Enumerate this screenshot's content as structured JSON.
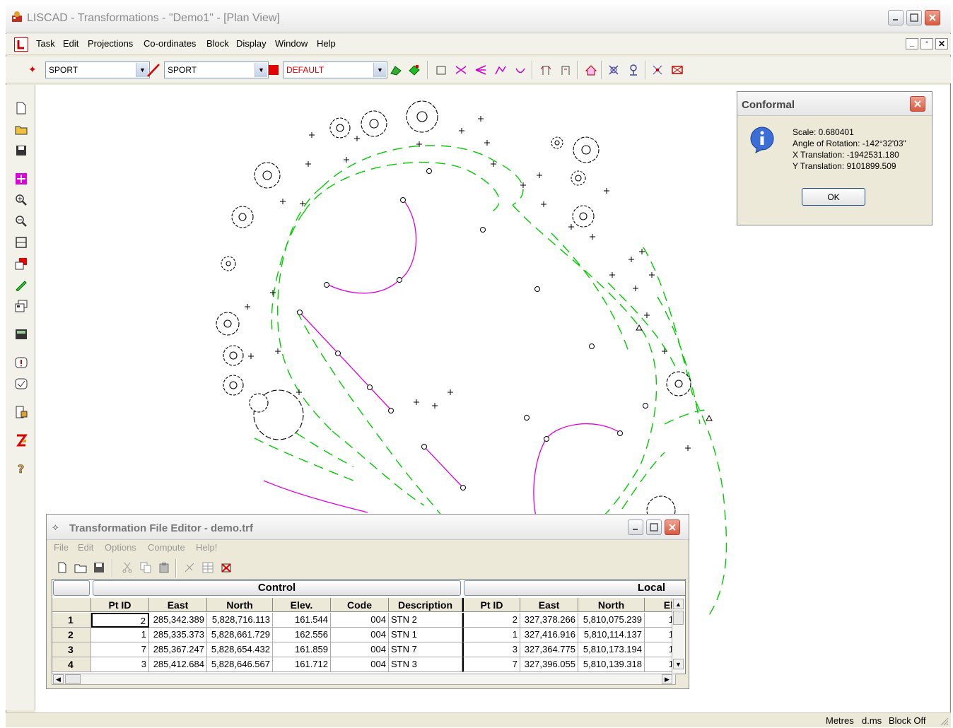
{
  "app": {
    "title": "LISCAD - Transformations - \"Demo1\" - [Plan View]"
  },
  "menubar": {
    "items": [
      "Task",
      "Edit",
      "Projections",
      "Co-ordinates",
      "Block",
      "Display",
      "Window",
      "Help"
    ]
  },
  "toolbar": {
    "point_layer": "SPORT",
    "line_layer": "SPORT",
    "color_layer": "DEFAULT"
  },
  "conformal_dialog": {
    "title": "Conformal",
    "scale": "Scale:  0.680401",
    "rotation": "Angle of Rotation: -142°32'03\"",
    "x_translation": "X Translation: -1942531.180",
    "y_translation": "Y Translation: 9101899.509",
    "ok_label": "OK"
  },
  "editor": {
    "title": "Transformation File Editor - demo.trf",
    "menu": [
      "File",
      "Edit",
      "Options",
      "Compute",
      "Help!"
    ],
    "group_headers": {
      "control": "Control",
      "local": "Local"
    },
    "columns": [
      "Pt ID",
      "East",
      "North",
      "Elev.",
      "Code",
      "Description",
      "Pt ID",
      "East",
      "North",
      "El"
    ],
    "rows": [
      {
        "num": "1",
        "c_id": "2",
        "c_east": "285,342.389",
        "c_north": "5,828,716.113",
        "c_elev": "161.544",
        "code": "004",
        "desc": "STN 2",
        "l_id": "2",
        "l_east": "327,378.266",
        "l_north": "5,810,075.239",
        "l_el": "1"
      },
      {
        "num": "2",
        "c_id": "1",
        "c_east": "285,335.373",
        "c_north": "5,828,661.729",
        "c_elev": "162.556",
        "code": "004",
        "desc": "STN 1",
        "l_id": "1",
        "l_east": "327,416.916",
        "l_north": "5,810,114.137",
        "l_el": "1"
      },
      {
        "num": "3",
        "c_id": "7",
        "c_east": "285,367.247",
        "c_north": "5,828,654.432",
        "c_elev": "161.859",
        "code": "004",
        "desc": "STN 7",
        "l_id": "3",
        "l_east": "327,364.775",
        "l_north": "5,810,173.194",
        "l_el": "1"
      },
      {
        "num": "4",
        "c_id": "3",
        "c_east": "285,412.684",
        "c_north": "5,828,646.567",
        "c_elev": "161.712",
        "code": "004",
        "desc": "STN 3",
        "l_id": "7",
        "l_east": "327,396.055",
        "l_north": "5,810,139.318",
        "l_el": "1"
      }
    ]
  },
  "statusbar": {
    "units": "Metres",
    "angle": "d.ms",
    "block": "Block Off"
  },
  "colors": {
    "green_lines": "#00cc00",
    "magenta_lines": "#e000e0",
    "accent_red": "#d00000"
  }
}
